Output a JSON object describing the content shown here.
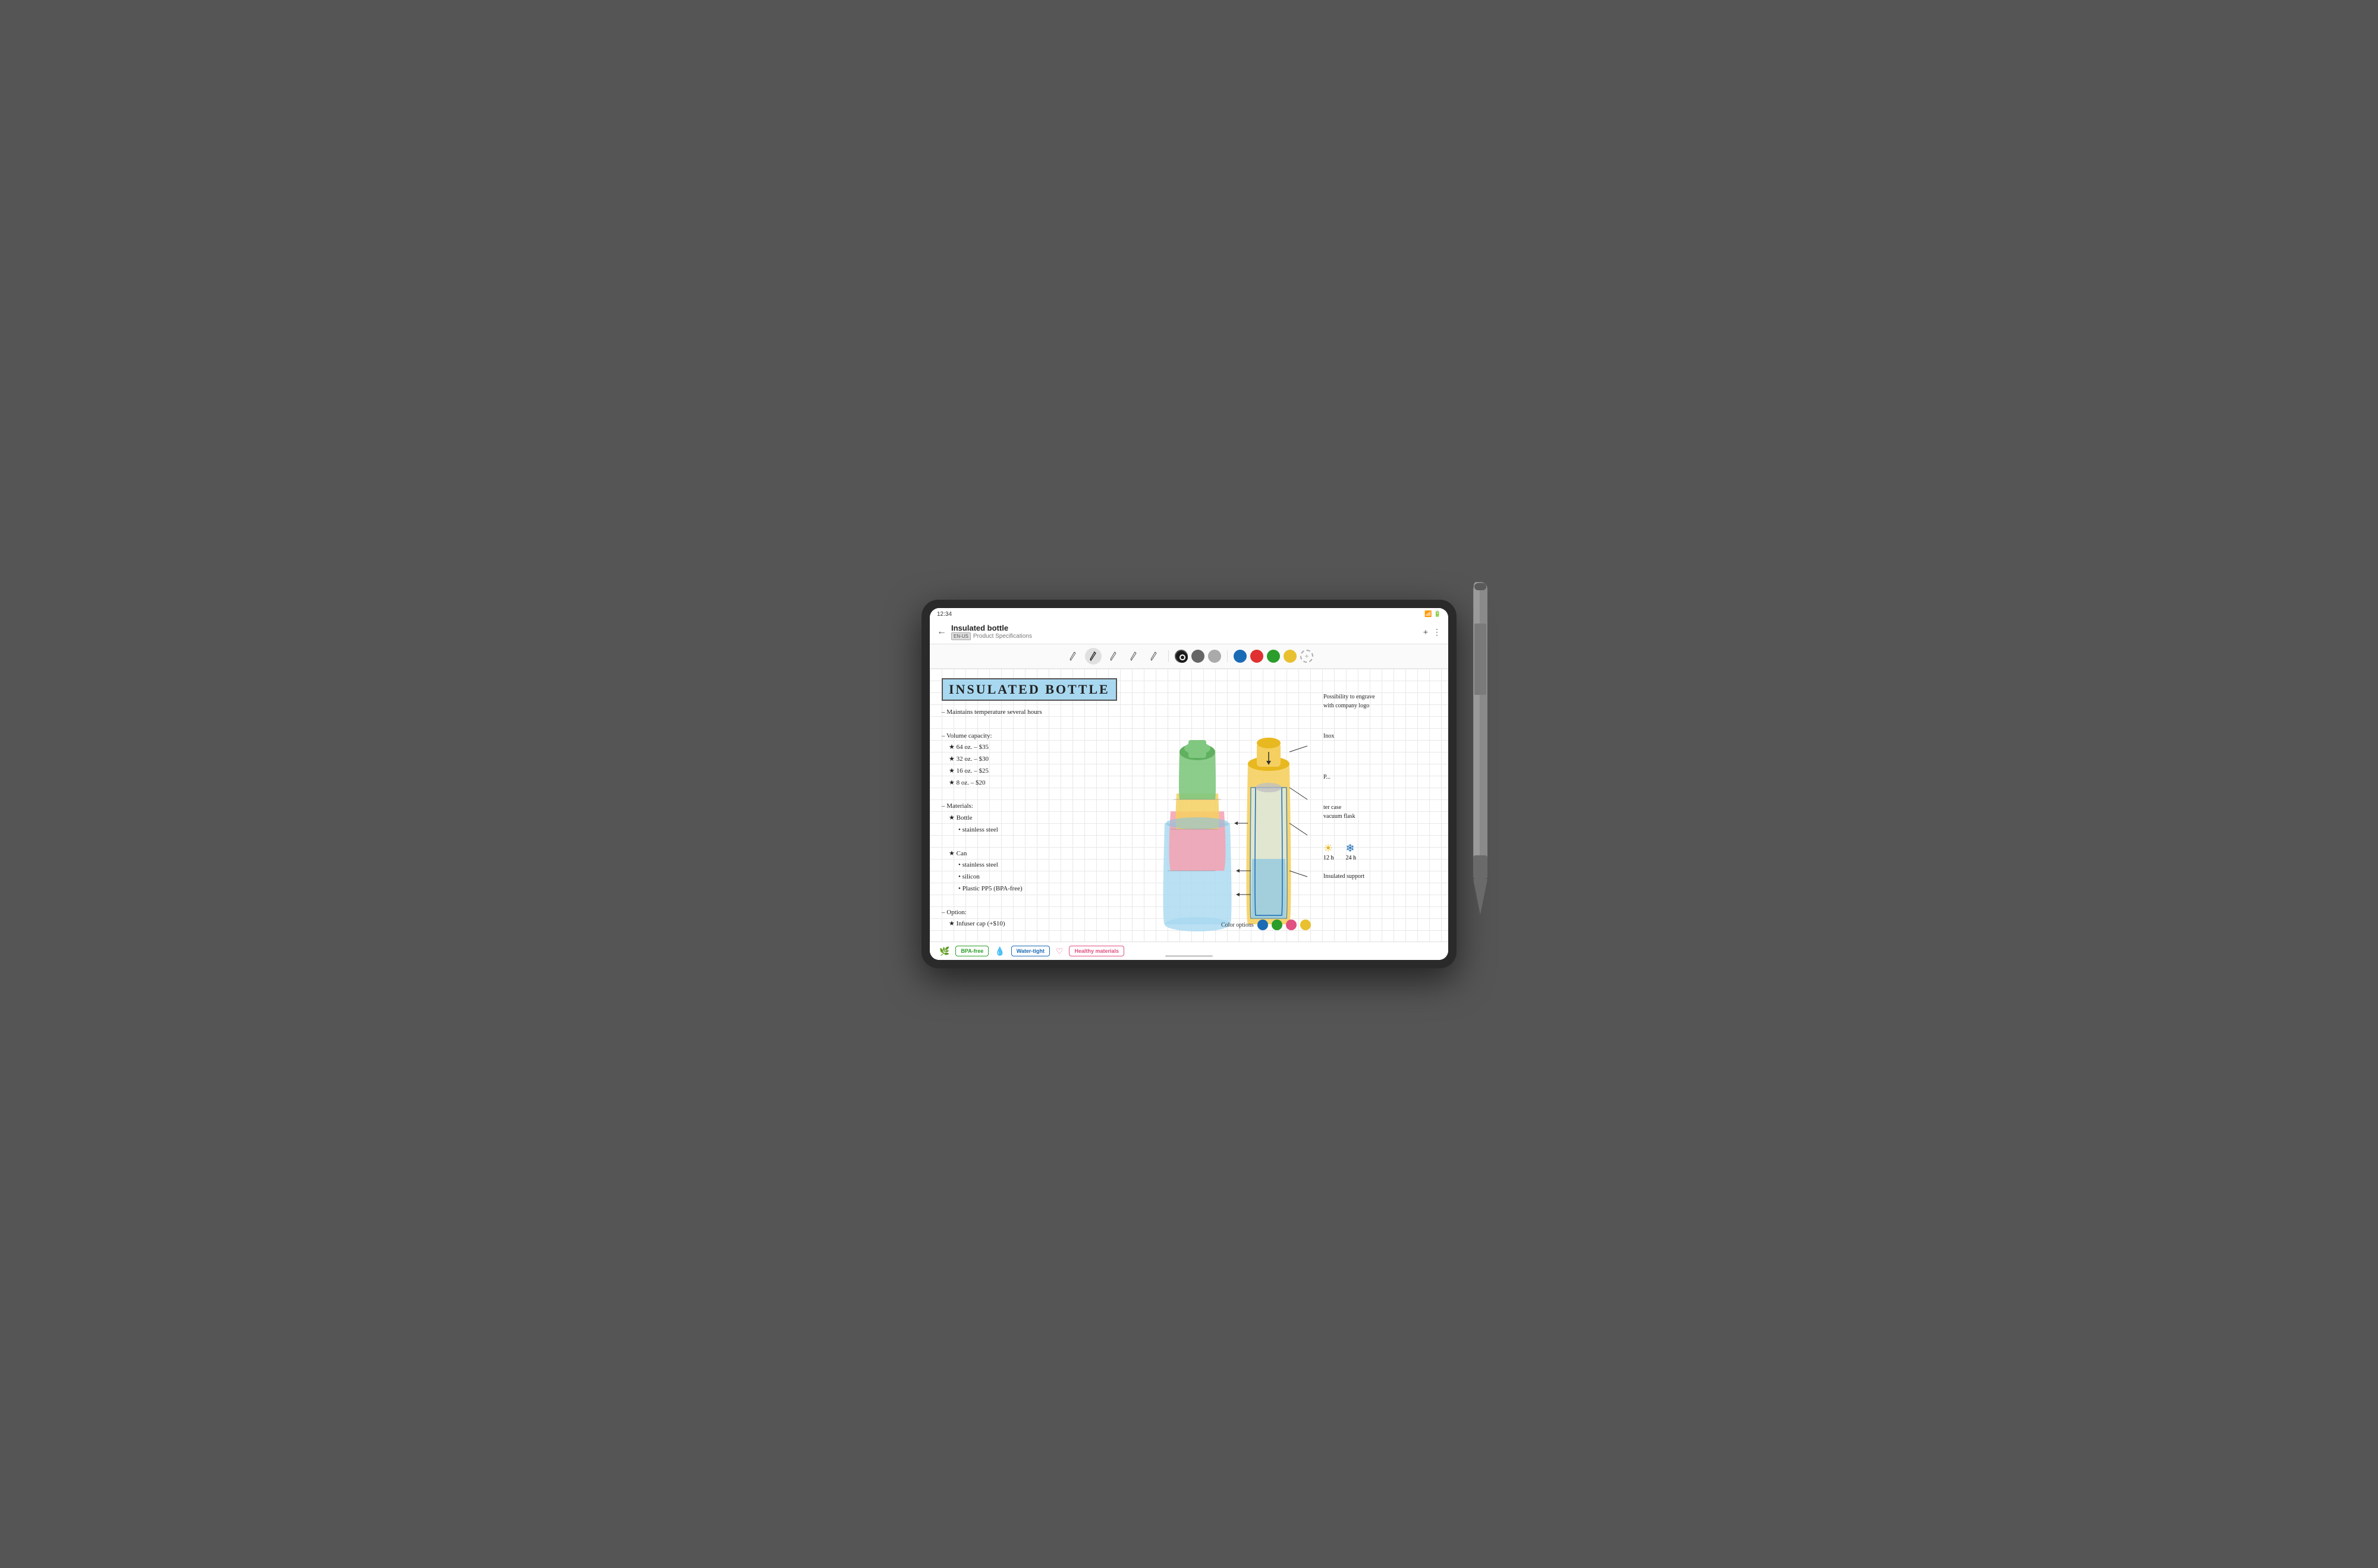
{
  "status_bar": {
    "time": "12:34"
  },
  "header": {
    "back_label": "←",
    "title": "Insulated bottle",
    "lang_badge": "EN-US",
    "subtitle": "Product Specifications",
    "plus_label": "+",
    "more_label": "⋮"
  },
  "toolbar": {
    "pen_tools": [
      "✒",
      "✒",
      "✒",
      "✒",
      "✒"
    ],
    "colors_basic": [
      {
        "name": "black",
        "hex": "#1a1a1a"
      },
      {
        "name": "dark-gray",
        "hex": "#666666"
      },
      {
        "name": "light-gray",
        "hex": "#aaaaaa"
      }
    ],
    "colors_accent": [
      {
        "name": "blue",
        "hex": "#1a6bb5"
      },
      {
        "name": "red",
        "hex": "#e03030"
      },
      {
        "name": "green",
        "hex": "#2a9d2a"
      },
      {
        "name": "yellow",
        "hex": "#e8c030"
      }
    ],
    "add_color_label": "+"
  },
  "content": {
    "title": "INSULATED BOTTLE",
    "title_bg": "#a8d8f0",
    "lines": [
      "– Maintains temperature several",
      "  hours",
      "",
      "– Volume capacity:",
      "  ★ 64 oz. – $35",
      "  ★ 32 oz. – $30",
      "  ★ 16 oz. – $25",
      "  ★ 8 oz. – $20",
      "",
      "– Materials:",
      "  ★ Bottle",
      "    • stainless steel",
      "",
      "  ★ Can",
      "    • stainless steel",
      "    • silicon",
      "    • Plastic PP5 (BPA-free)",
      "",
      "– Option:",
      "  ★ Infuser cap (+$10)"
    ],
    "right_annotations": [
      "Possibility to engrave",
      "with company logo",
      "",
      "Inox",
      "",
      "P...",
      "",
      "ter case",
      "vacuum flask",
      "",
      "12 h    24 h",
      "",
      "Insulated support"
    ],
    "color_options_label": "Color options",
    "color_options": [
      {
        "name": "blue",
        "hex": "#1a6bb5"
      },
      {
        "name": "green",
        "hex": "#2a9d2a"
      },
      {
        "name": "pink",
        "hex": "#e05080"
      },
      {
        "name": "yellow",
        "hex": "#e8c030"
      }
    ]
  },
  "badges": [
    {
      "icon": "🌿",
      "label": "BPA-free",
      "style": "green"
    },
    {
      "icon": "💧",
      "label": "Water-tight",
      "style": "blue"
    },
    {
      "icon": "♡",
      "label": "Healthy materials",
      "style": "pink"
    }
  ]
}
